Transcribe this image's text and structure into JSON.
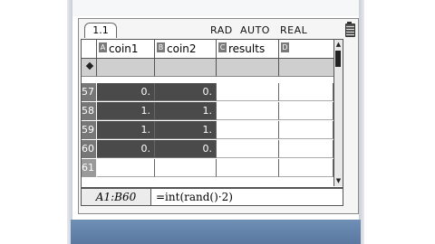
{
  "tab": {
    "label": "1.1"
  },
  "status": {
    "angle": "RAD",
    "mode": "AUTO",
    "format": "REAL"
  },
  "columns": [
    {
      "letter": "A",
      "name": "coin1"
    },
    {
      "letter": "B",
      "name": "coin2"
    },
    {
      "letter": "C",
      "name": "results"
    },
    {
      "letter": "D",
      "name": ""
    }
  ],
  "rows": [
    {
      "num": "57",
      "a": "0.",
      "b": "0."
    },
    {
      "num": "58",
      "a": "1.",
      "b": "1."
    },
    {
      "num": "59",
      "a": "1.",
      "b": "1."
    },
    {
      "num": "60",
      "a": "0.",
      "b": "0."
    },
    {
      "num": "61",
      "a": "",
      "b": ""
    }
  ],
  "entry": {
    "cell_ref": "A1:B60",
    "formula": "=int(rand()·2)"
  },
  "colors": {
    "selection": "#4a4a4a",
    "bottom_band": "#6f8fb5"
  }
}
